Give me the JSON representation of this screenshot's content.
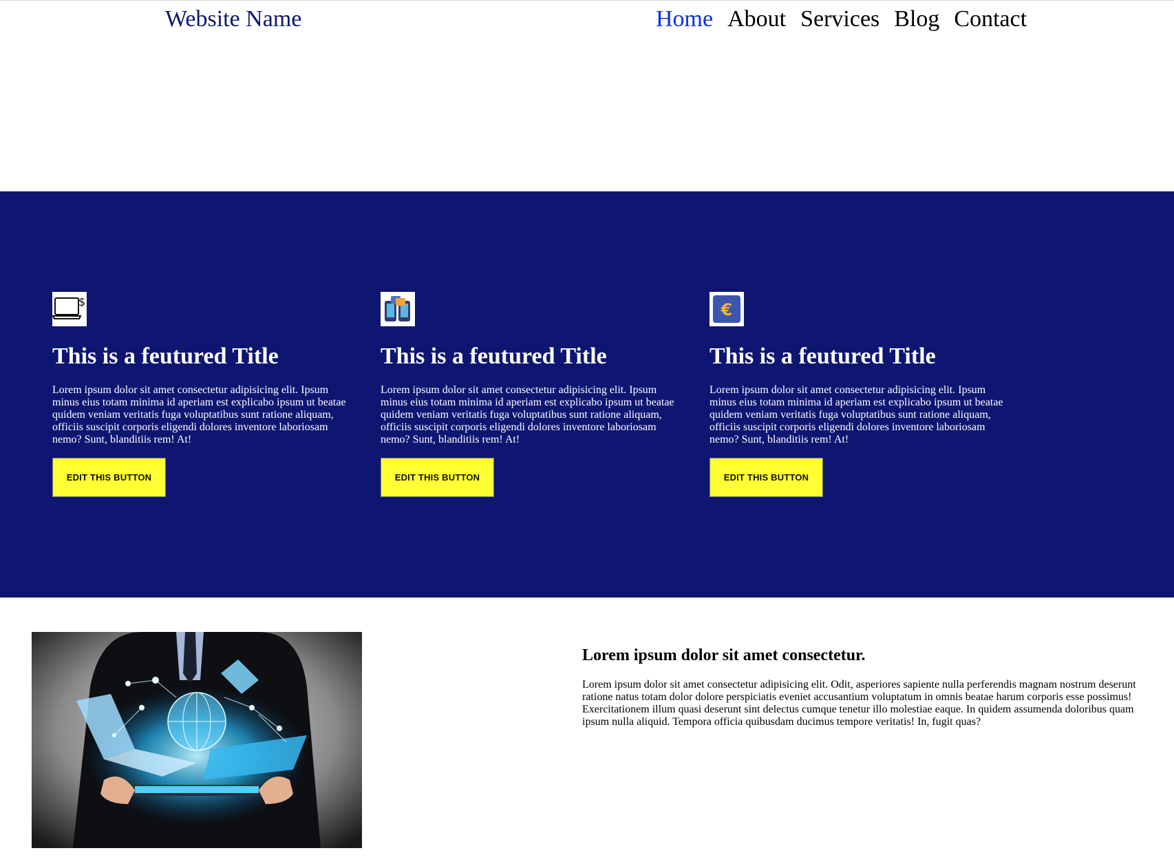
{
  "header": {
    "brand": "Website Name",
    "nav": [
      {
        "label": "Home",
        "active": true
      },
      {
        "label": "About"
      },
      {
        "label": "Services"
      },
      {
        "label": "Blog"
      },
      {
        "label": "Contact"
      }
    ]
  },
  "features": {
    "background_color": "#0e1672",
    "items": [
      {
        "icon": "laptop-dollar-icon",
        "title": "This is a feutured Title",
        "text": "Lorem ipsum dolor sit amet consectetur adipisicing elit. Ipsum minus eius totam minima id aperiam est explicabo ipsum ut beatae quidem veniam veritatis fuga voluptatibus sunt ratione aliquam, officiis suscipit corporis eligendi dolores inventore laboriosam nemo? Sunt, blanditiis rem! At!",
        "button": "EDIT THIS BUTTON"
      },
      {
        "icon": "phones-chat-icon",
        "title": "This is a feutured Title",
        "text": "Lorem ipsum dolor sit amet consectetur adipisicing elit. Ipsum minus eius totam minima id aperiam est explicabo ipsum ut beatae quidem veniam veritatis fuga voluptatibus sunt ratione aliquam, officiis suscipit corporis eligendi dolores inventore laboriosam nemo? Sunt, blanditiis rem! At!",
        "button": "EDIT THIS BUTTON"
      },
      {
        "icon": "euro-icon",
        "title": "This is a feutured Title",
        "text": "Lorem ipsum dolor sit amet consectetur adipisicing elit. Ipsum minus eius totam minima id aperiam est explicabo ipsum ut beatae quidem veniam veritatis fuga voluptatibus sunt ratione aliquam, officiis suscipit corporis eligendi dolores inventore laboriosam nemo? Sunt, blanditiis rem! At!",
        "button": "EDIT THIS BUTTON"
      }
    ],
    "button_color": "#ffff33"
  },
  "about": {
    "heading": "Lorem ipsum dolor sit amet consectetur.",
    "text": "Lorem ipsum dolor sit amet consectetur adipisicing elit. Odit, asperiores sapiente nulla perferendis magnam nostrum deserunt ratione natus totam dolor dolore perspiciatis eveniet accusantium voluptatum in omnis beatae harum corporis esse possimus! Exercitationem illum quasi deserunt sint delectus cumque tenetur illo molestiae eaque. In quidem assumenda doloribus quam ipsum nulla aliquid. Tempora officia quibusdam ducimus tempore veritatis! In, fugit quas?",
    "image": "businessman-holding-tablet-technology-image"
  }
}
